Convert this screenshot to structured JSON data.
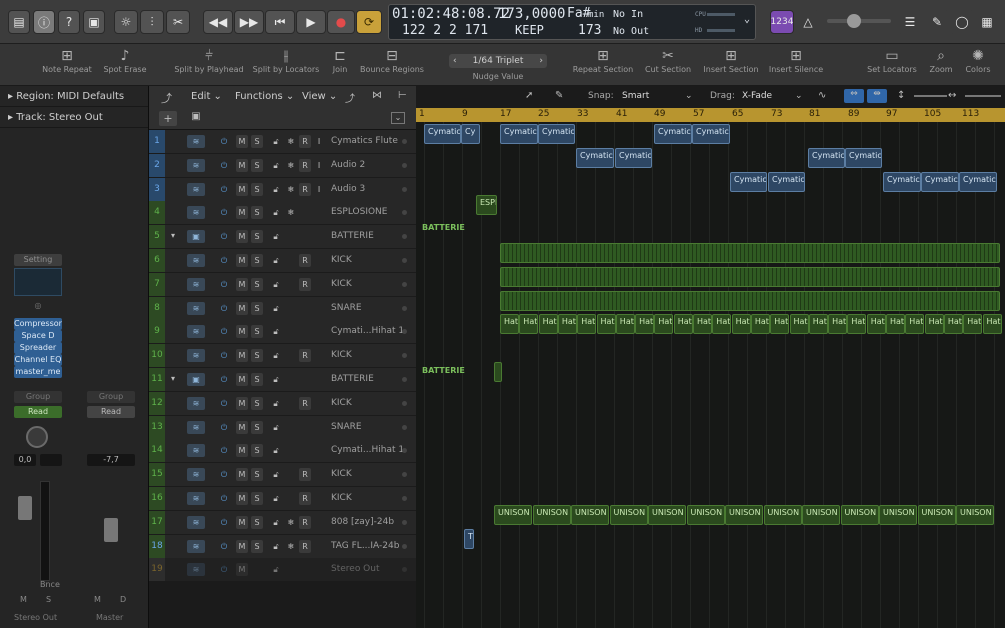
{
  "control_bar": {
    "display": {
      "time": "01:02:48:08.72",
      "bars": "122 2 2 171",
      "tempo": "173,0000",
      "tempo_mode": "KEEP",
      "key": "Fa#",
      "key_mode": "min",
      "key_alt": "173",
      "in": "No In",
      "out": "No Out",
      "lcd_cpu": "CPU",
      "lcd_hd": "HD"
    },
    "count_in": "1234"
  },
  "toolbar": {
    "items": [
      "Note Repeat",
      "Spot Erase",
      "Split by Playhead",
      "Split by Locators",
      "Join",
      "Bounce Regions",
      "Nudge Value",
      "Repeat Section",
      "Cut Section",
      "Insert Section",
      "Insert Silence",
      "Set Locators",
      "Zoom",
      "Colors"
    ],
    "nudge_value": "1/64 Triplet"
  },
  "inspector": {
    "region": "Region: MIDI Defaults",
    "track": "Track: Stereo Out",
    "setting": "Setting",
    "plugins": [
      "Compressor",
      "Space D",
      "Spreader",
      "Channel EQ",
      "master_me"
    ],
    "group": "Group",
    "read": "Read",
    "vol_left": "0,0",
    "vol_right": "-7,7",
    "bnce": "Bnce",
    "left_buttons": [
      "M",
      "S"
    ],
    "right_buttons": [
      "M",
      "D"
    ],
    "left_name": "Stereo Out",
    "right_name": "Master"
  },
  "local": {
    "edit": "Edit",
    "functions": "Functions",
    "view": "View",
    "snap_label": "Snap:",
    "snap": "Smart",
    "drag_label": "Drag:",
    "drag": "X-Fade"
  },
  "ruler": [
    "1",
    "9",
    "17",
    "25",
    "33",
    "41",
    "49",
    "57",
    "65",
    "73",
    "81",
    "89",
    "97",
    "105",
    "113"
  ],
  "tracks": [
    {
      "num": "1",
      "name": "Cymatics Flute"
    },
    {
      "num": "2",
      "name": "Audio 2"
    },
    {
      "num": "3",
      "name": "Audio 3"
    },
    {
      "num": "4",
      "name": "ESPLOSIONE"
    },
    {
      "num": "5",
      "name": "BATTERIE"
    },
    {
      "num": "6",
      "name": "KICK"
    },
    {
      "num": "7",
      "name": "KICK"
    },
    {
      "num": "8",
      "name": "SNARE"
    },
    {
      "num": "9",
      "name": "Cymati...Hihat 1"
    },
    {
      "num": "10",
      "name": "KICK"
    },
    {
      "num": "11",
      "name": "BATTERIE"
    },
    {
      "num": "12",
      "name": "KICK"
    },
    {
      "num": "13",
      "name": "SNARE"
    },
    {
      "num": "14",
      "name": "Cymati...Hihat 1"
    },
    {
      "num": "15",
      "name": "KICK"
    },
    {
      "num": "16",
      "name": "KICK"
    },
    {
      "num": "17",
      "name": "808 [zay]-24b"
    },
    {
      "num": "18",
      "name": "TAG FL...IA-24b"
    },
    {
      "num": "19",
      "name": "Stereo Out"
    }
  ],
  "track_buttons": {
    "mute": "M",
    "solo": "S",
    "record": "R",
    "input": "I"
  },
  "folder_labels": [
    "BATTERIE",
    "BATTERIE"
  ],
  "regions": {
    "cymatics": "Cymatics",
    "cymatic": "Cymatic",
    "cy": "Cy",
    "espl": "ESPL",
    "hat": "Hat",
    "unison": "UNISON",
    "tag": "T"
  },
  "colors": {
    "ruler": "#b8952f",
    "audio_region": "#2e4764",
    "midi_region": "#2b4a1e"
  }
}
